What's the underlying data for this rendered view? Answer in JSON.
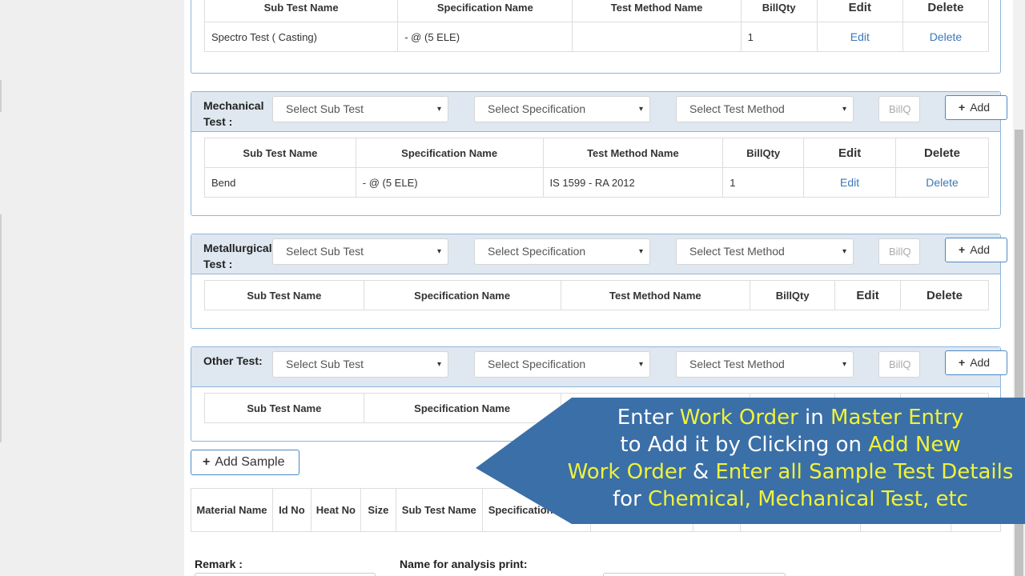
{
  "colors": {
    "panel_border": "#8fb6d9",
    "panel_header": "#dfe7f0",
    "link": "#3a78b8",
    "callout_bg": "#3a6fa8",
    "callout_highlight": "#f0f23a"
  },
  "icons": {
    "caret": "caret-down-icon",
    "plus": "plus-icon"
  },
  "columns": {
    "sub_test": "Sub Test Name",
    "specification": "Specification Name",
    "test_method": "Test Method Name",
    "bill_qty": "BillQty",
    "edit": "Edit",
    "delete": "Delete"
  },
  "controls": {
    "select_sub_test": "Select Sub Test",
    "select_specification": "Select Specification",
    "select_test_method": "Select Test Method",
    "billq_placeholder": "BillQ",
    "add_label": "Add",
    "caret": "▾",
    "plus": "+"
  },
  "chemical": {
    "rows": [
      {
        "sub_test": "Spectro Test ( Casting)",
        "specification": "- @ (5 ELE)",
        "test_method": "",
        "bill_qty": "1",
        "edit": "Edit",
        "delete": "Delete"
      }
    ]
  },
  "mechanical": {
    "label": "Mechanical Test :",
    "rows": [
      {
        "sub_test": "Bend",
        "specification": "- @ (5 ELE)",
        "test_method": "IS 1599 - RA 2012",
        "bill_qty": "1",
        "edit": "Edit",
        "delete": "Delete"
      }
    ]
  },
  "metallurgical": {
    "label": "Metallurgical Test :"
  },
  "other": {
    "label": "Other Test:"
  },
  "add_sample": "Add Sample",
  "samples_table": {
    "headers": [
      "Material Name",
      "Id No",
      "Heat No",
      "Size",
      "Sub Test Name",
      "Specification Name"
    ]
  },
  "form": {
    "remark_label": "Remark :",
    "analysis_label": "Name for analysis print:"
  },
  "callout": {
    "line1": [
      "Enter ",
      "Work Order",
      " in ",
      "Master Entry"
    ],
    "line2": [
      "to Add it by Clicking on ",
      "Add New"
    ],
    "line3": [
      "Work Order",
      " & ",
      "Enter all Sample Test Details"
    ],
    "line4": [
      "for ",
      "Chemical, Mechanical Test, etc"
    ]
  }
}
